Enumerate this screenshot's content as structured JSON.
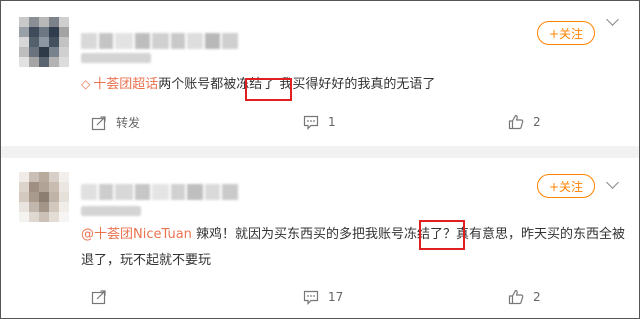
{
  "posts": [
    {
      "follow_label": "+关注",
      "mention": "十荟团超话",
      "text": "两个账号都被冻结了 我买得好好的我真的无语了",
      "share_label": "转发",
      "comment_count": "1",
      "like_count": "2",
      "avatar_colors": [
        "#c9c9c9",
        "#8a8f96",
        "#b8b8b8",
        "#7c828a",
        "#cfcfcf",
        "#9aa0a8",
        "#3f4b5a",
        "#6d7784",
        "#2f3d4e",
        "#a3a3a3",
        "#d7d7d7",
        "#55606d",
        "#8d97a3",
        "#44505d",
        "#c3c3c3",
        "#bdbdbd",
        "#6a737d",
        "#2e3a48",
        "#78828c",
        "#d0d0d0",
        "#e2e2e2",
        "#a5a5a5",
        "#5a6470",
        "#b3b3b3",
        "#dcdcdc"
      ],
      "name_blur_colors": [
        "#d9d9d9",
        "#c4c4c4",
        "#e3e3e3",
        "#bdbdbd",
        "#d0d0d0",
        "#c9c9c9",
        "#dedede",
        "#b8b8b8",
        "#cfcfcf"
      ]
    },
    {
      "follow_label": "+关注",
      "mention": "@十荟团NiceTuan",
      "text": " 辣鸡！就因为买东西买的多把我账号冻结了？真有意思，昨天买的东西全被退了，玩不起就不要玩",
      "share_label": "",
      "comment_count": "17",
      "like_count": "2",
      "avatar_colors": [
        "#f0ebe6",
        "#c9bfb6",
        "#b7aa9d",
        "#d8d0c8",
        "#f2efec",
        "#dcd3ca",
        "#9e8f82",
        "#b1a396",
        "#c8bcb0",
        "#ebe6e1",
        "#d4c9be",
        "#a89a8c",
        "#8c7e71",
        "#bfb3a7",
        "#e6e0da",
        "#e9e4df",
        "#c2b7ac",
        "#a39588",
        "#d2c8be",
        "#f1eeea",
        "#f5f3f0",
        "#dfd8d1",
        "#cbc1b7",
        "#e4ddd6",
        "#f7f5f3"
      ],
      "name_blur_colors": [
        "#e0e0e0",
        "#cdcdcd",
        "#d8d8d8",
        "#c6c6c6",
        "#e4e4e4",
        "#d1d1d1",
        "#bfbfbf",
        "#dadada",
        "#cacaca"
      ]
    }
  ],
  "colors": {
    "accent": "#ff8200",
    "mention": "#eb7350",
    "highlight_box": "#e02020",
    "separator": "#f2f2f2"
  },
  "icons": {
    "chaohua": "diamond-icon",
    "share": "share-icon",
    "comment": "comment-icon",
    "like": "thumbs-up-icon",
    "more": "chevron-down-icon"
  }
}
